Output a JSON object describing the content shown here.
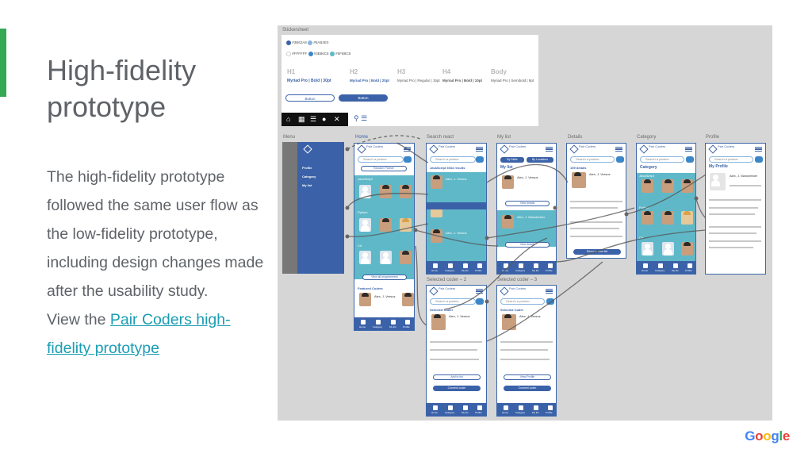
{
  "slide": {
    "title": "High-fidelity prototype",
    "body_line": "The high-fidelity prototype followed the same user flow as the low-fidelity prototype, including design changes made after the usability study.",
    "view_prefix": "View the ",
    "link_text": "Pair Coders high-fidelity prototype",
    "accent_color": "#34a853",
    "link_color": "#1a9db3"
  },
  "logo": {
    "letters": [
      "G",
      "o",
      "o",
      "g",
      "l",
      "e"
    ],
    "colors": [
      "#4285f4",
      "#ea4335",
      "#fbbc05",
      "#4285f4",
      "#34a853",
      "#ea4335"
    ]
  },
  "board": {
    "stickersheet_label": "Stickersheet",
    "screen_labels": {
      "menu": "Menu",
      "home": "Home",
      "search": "Search react",
      "mylist": "My list",
      "details": "Details",
      "category": "Category",
      "profile": "Profile",
      "selected2": "Selected coder – 2",
      "selected3": "Selected coder – 3"
    },
    "stickersheet": {
      "legend": [
        "#3B62A8",
        "#8AB4E0",
        "#FFFFFF",
        "#3B86C8",
        "#5FB8C8"
      ],
      "type_heads": [
        "H1",
        "H2",
        "H3",
        "H4",
        "Body"
      ],
      "type_specs": [
        "Myriad Pro | Bold | 30pt",
        "Myriad Pro | Bold | 20pt",
        "Myriad Pro | Regular | 15pt",
        "Myriad Pro | Bold | 10pt",
        "Myriad Pro | Semibold | 8pt"
      ],
      "button_outline": "Button",
      "button_filled": "Button"
    },
    "screens": {
      "logo": "Pair Coders",
      "search_placeholder": "Search a partner",
      "home_cta": "Random Partner",
      "home_sections": [
        "JavaScript",
        "Python",
        "C#"
      ],
      "home_view_all": "View all programmers",
      "home_featured": "Featured Coders",
      "search_result_title": "JavaScript 3034 results",
      "mylist_title": "My list",
      "mylist_tabs": [
        "By Skills",
        "By Locations"
      ],
      "details_title": "159 details",
      "category_title": "Category",
      "profile_title": "My Profile",
      "profile_name": "Alex, J. Manchester",
      "view_details": "View details",
      "remove_from_list": "Remove from list",
      "add_to_list": "Add to list",
      "connect_coder": "Connect coder",
      "view_profile": "View Profile",
      "selected_coder": "Selected Coder",
      "coder_name": "Alex, J. Versus",
      "nav": [
        "Home",
        "Category",
        "My list",
        "Profile"
      ]
    },
    "menu_items": [
      "Profile",
      "Category",
      "My list"
    ]
  }
}
